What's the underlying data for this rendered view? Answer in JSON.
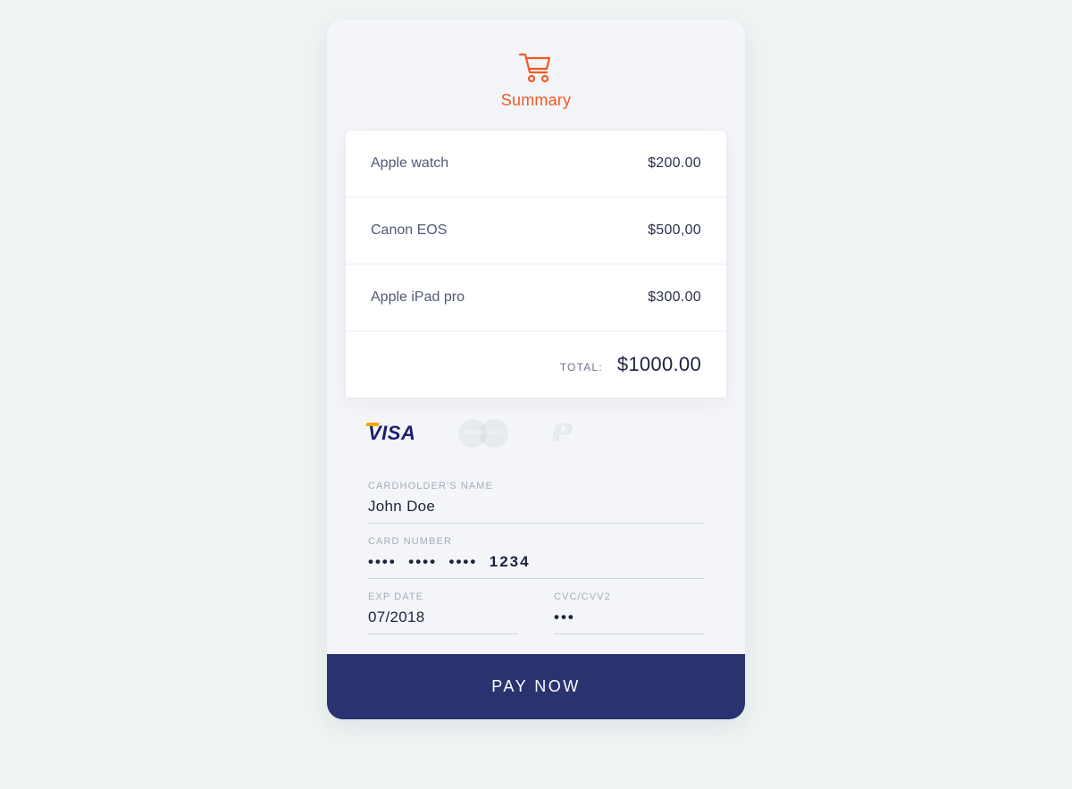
{
  "header": {
    "icon": "cart-icon",
    "title": "Summary",
    "accent_color": "#f05a24"
  },
  "items": [
    {
      "name": "Apple watch",
      "price": "$200.00"
    },
    {
      "name": "Canon EOS",
      "price": "$500,00"
    },
    {
      "name": "Apple iPad  pro",
      "price": "$300.00"
    }
  ],
  "total": {
    "label": "TOTAL:",
    "value": "$1000.00"
  },
  "payment_methods": {
    "visa": {
      "label": "VISA",
      "selected": true
    },
    "mastercard": {
      "label": "MasterCard",
      "selected": false
    },
    "paypal": {
      "label": "P",
      "selected": false
    }
  },
  "form": {
    "cardholder": {
      "label": "CARDHOLDER'S NAME",
      "value": "John Doe"
    },
    "cardnumber": {
      "label": "CARD NUMBER",
      "value": "••••  ••••  ••••  1234"
    },
    "exp": {
      "label": "EXP DATE",
      "value": "07/2018"
    },
    "cvc": {
      "label": "CVC/CVV2",
      "value": "•••"
    }
  },
  "actions": {
    "pay_label": "PAY NOW"
  },
  "colors": {
    "accent": "#f05a24",
    "primary": "#2a3370"
  }
}
